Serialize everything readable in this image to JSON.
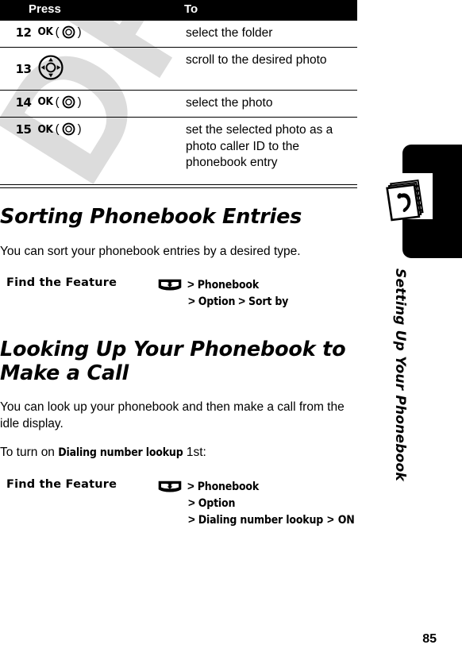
{
  "page": {
    "number": "85",
    "watermark": "DRAFT"
  },
  "sidebar": {
    "chapter_title": "Setting Up Your Phonebook",
    "icon": "phonebook-icon"
  },
  "table": {
    "headers": {
      "press": "Press",
      "to": "To"
    },
    "rows": [
      {
        "num": "12",
        "press_key": "OK",
        "press_icon": "ok-circle-icon",
        "press_has_parens": true,
        "to": "select the folder"
      },
      {
        "num": "13",
        "press_key": "",
        "press_icon": "navigation-key-icon",
        "press_has_parens": false,
        "to": "scroll to the desired photo"
      },
      {
        "num": "14",
        "press_key": "OK",
        "press_icon": "ok-circle-icon",
        "press_has_parens": true,
        "to": "select the photo"
      },
      {
        "num": "15",
        "press_key": "OK",
        "press_icon": "ok-circle-icon",
        "press_has_parens": true,
        "to": "set the selected photo as a photo caller ID to the phonebook entry"
      }
    ]
  },
  "sections": [
    {
      "heading": "Sorting Phonebook Entries",
      "body": "You can sort your phonebook entries by a desired type.",
      "find_feature": {
        "label": "Find the Feature",
        "icon": "menu-key-icon",
        "lines": [
          {
            "sep": ">",
            "items": [
              "Phonebook"
            ]
          },
          {
            "sep": ">",
            "items": [
              "Option",
              "Sort by"
            ]
          }
        ]
      }
    },
    {
      "heading": "Looking Up Your Phonebook to Make a Call",
      "body": "You can look up your phonebook and then make a call from the idle display.",
      "body2_prefix": "To turn on ",
      "body2_keyword": "Dialing number lookup",
      "body2_suffix": " 1st:",
      "find_feature": {
        "label": "Find the Feature",
        "icon": "menu-key-icon",
        "lines": [
          {
            "sep": ">",
            "items": [
              "Phonebook"
            ]
          },
          {
            "sep": ">",
            "items": [
              "Option"
            ]
          },
          {
            "sep": ">",
            "items": [
              "Dialing number lookup",
              "ON"
            ]
          }
        ]
      }
    }
  ],
  "colors": {
    "ink": "#000000",
    "paper": "#ffffff",
    "watermark": "#dcdcdc"
  }
}
